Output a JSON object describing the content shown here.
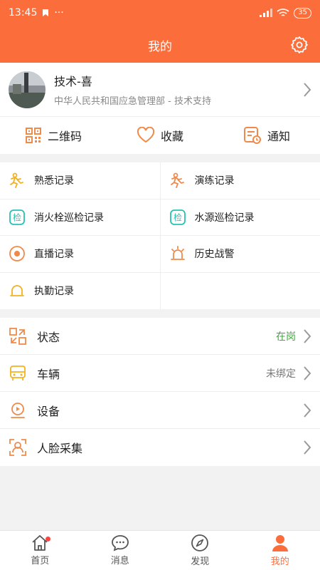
{
  "status_bar": {
    "time": "13:45",
    "dots": "···",
    "battery": "35"
  },
  "header": {
    "title": "我的"
  },
  "profile": {
    "name": "技术-喜",
    "org": "中华人民共和国应急管理部 - 技术支持"
  },
  "quick_actions": [
    {
      "label": "二维码",
      "icon": "qrcode-icon"
    },
    {
      "label": "收藏",
      "icon": "heart-icon"
    },
    {
      "label": "通知",
      "icon": "notice-icon"
    }
  ],
  "records": [
    {
      "label": "熟悉记录",
      "icon": "runner-icon"
    },
    {
      "label": "演练记录",
      "icon": "runner-icon"
    },
    {
      "label": "消火栓巡检记录",
      "icon": "inspect-icon",
      "glyph": "检"
    },
    {
      "label": "水源巡检记录",
      "icon": "inspect-icon",
      "glyph": "检"
    },
    {
      "label": "直播记录",
      "icon": "live-icon"
    },
    {
      "label": "历史战警",
      "icon": "siren-icon"
    },
    {
      "label": "执勤记录",
      "icon": "duty-icon"
    }
  ],
  "settings": [
    {
      "label": "状态",
      "value": "在岗",
      "icon": "status-icon"
    },
    {
      "label": "车辆",
      "value": "未绑定",
      "icon": "vehicle-icon"
    },
    {
      "label": "设备",
      "value": "",
      "icon": "device-icon"
    },
    {
      "label": "人脸采集",
      "value": "",
      "icon": "face-icon"
    }
  ],
  "tabs": [
    {
      "label": "首页",
      "icon": "home-icon"
    },
    {
      "label": "消息",
      "icon": "message-icon"
    },
    {
      "label": "发现",
      "icon": "compass-icon"
    },
    {
      "label": "我的",
      "icon": "person-icon"
    }
  ],
  "colors": {
    "accent": "#fb6d3b",
    "orange_icon": "#f08a4b",
    "yellow_icon": "#f2b21f",
    "teal_icon": "#27c2b0",
    "ok_green": "#3aa83a"
  }
}
